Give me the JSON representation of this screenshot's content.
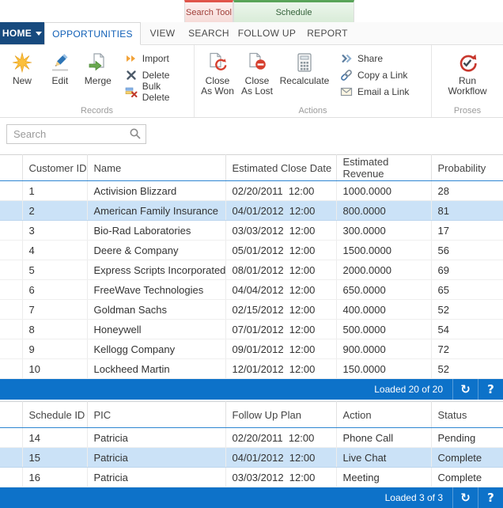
{
  "colors": {
    "accent_blue": "#1160b7",
    "status_bar_blue": "#0d72c9",
    "selected_row": "#cbe2f7",
    "home_navy": "#174a7e",
    "context_red": "#e0544a",
    "context_green": "#58a458"
  },
  "contextual": {
    "search_tool": "Search Tool",
    "schedule": "Schedule"
  },
  "tabs": {
    "home": "HOME",
    "opportunities": "OPPORTUNITIES",
    "view": "VIEW",
    "search": "SEARCH",
    "follow_up": "FOLLOW UP",
    "report": "REPORT"
  },
  "ribbon": {
    "records": {
      "label": "Records",
      "new": "New",
      "edit": "Edit",
      "merge": "Merge",
      "import": "Import",
      "delete": "Delete",
      "bulk_delete": "Bulk Delete"
    },
    "actions": {
      "label": "Actions",
      "close_as_won": "Close As Won",
      "close_as_lost": "Close As Lost",
      "recalculate": "Recalculate",
      "share": "Share",
      "copy_a_link": "Copy a Link",
      "email_a_link": "Email a Link"
    },
    "proses": {
      "label": "Proses",
      "run_workflow": "Run Workflow"
    }
  },
  "search": {
    "placeholder": "Search"
  },
  "status_icons": {
    "refresh": "↻",
    "help": "?"
  },
  "opportunities_grid": {
    "columns": {
      "customer_id": "Customer ID",
      "name": "Name",
      "close_date": "Estimated Close Date",
      "revenue": "Estimated Revenue",
      "probability": "Probability"
    },
    "rows": [
      {
        "customer_id": "1",
        "name": "Activision Blizzard",
        "close_date": "02/20/2011  12:00",
        "revenue": "1000.0000",
        "probability": "28",
        "selected": false
      },
      {
        "customer_id": "2",
        "name": "American Family Insurance",
        "close_date": "04/01/2012  12:00",
        "revenue": "800.0000",
        "probability": "81",
        "selected": true
      },
      {
        "customer_id": "3",
        "name": "Bio-Rad Laboratories",
        "close_date": "03/03/2012  12:00",
        "revenue": "300.0000",
        "probability": "17",
        "selected": false
      },
      {
        "customer_id": "4",
        "name": "Deere & Company",
        "close_date": "05/01/2012  12:00",
        "revenue": "1500.0000",
        "probability": "56",
        "selected": false
      },
      {
        "customer_id": "5",
        "name": "Express Scripts Incorporated",
        "close_date": "08/01/2012  12:00",
        "revenue": "2000.0000",
        "probability": "69",
        "selected": false
      },
      {
        "customer_id": "6",
        "name": "FreeWave Technologies",
        "close_date": "04/04/2012  12:00",
        "revenue": "650.0000",
        "probability": "65",
        "selected": false
      },
      {
        "customer_id": "7",
        "name": "Goldman Sachs",
        "close_date": "02/15/2012  12:00",
        "revenue": "400.0000",
        "probability": "52",
        "selected": false
      },
      {
        "customer_id": "8",
        "name": "Honeywell",
        "close_date": "07/01/2012  12:00",
        "revenue": "500.0000",
        "probability": "54",
        "selected": false
      },
      {
        "customer_id": "9",
        "name": "Kellogg Company",
        "close_date": "09/01/2012  12:00",
        "revenue": "900.0000",
        "probability": "72",
        "selected": false
      },
      {
        "customer_id": "10",
        "name": "Lockheed Martin",
        "close_date": "12/01/2012  12:00",
        "revenue": "150.0000",
        "probability": "52",
        "selected": false
      }
    ],
    "status": "Loaded 20 of 20"
  },
  "schedule_grid": {
    "columns": {
      "schedule_id": "Schedule ID",
      "pic": "PIC",
      "plan": "Follow Up Plan",
      "action": "Action",
      "status_col": "Status"
    },
    "rows": [
      {
        "schedule_id": "14",
        "pic": "Patricia",
        "plan": "02/20/2011  12:00",
        "action": "Phone Call",
        "status": "Pending",
        "selected": false
      },
      {
        "schedule_id": "15",
        "pic": "Patricia",
        "plan": "04/01/2012  12:00",
        "action": "Live Chat",
        "status": "Complete",
        "selected": true
      },
      {
        "schedule_id": "16",
        "pic": "Patricia",
        "plan": "03/03/2012  12:00",
        "action": "Meeting",
        "status": "Complete",
        "selected": false
      }
    ],
    "status": "Loaded 3 of 3"
  }
}
